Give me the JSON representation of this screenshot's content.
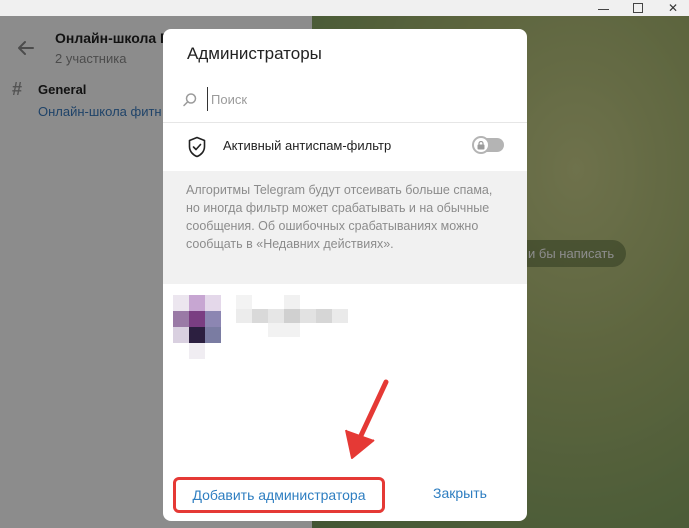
{
  "window": {
    "controls": {
      "minimize": "",
      "maximize": "",
      "close": "✕"
    }
  },
  "left": {
    "chat_title": "Онлайн-школа П",
    "chat_subtitle": "2 участника",
    "topic_name": "General",
    "topic_subtitle": "Онлайн-школа фитн"
  },
  "chat": {
    "hint": "и бы написать"
  },
  "modal": {
    "title": "Администраторы",
    "search_placeholder": "Поиск",
    "antispam_label": "Активный антиспам-фильтр",
    "antispam_enabled": false,
    "info_text": "Алгоритмы Telegram будут отсеивать больше спама, но иногда фильтр может срабатывать и на обычные сообщения. Об ошибочных срабатываниях можно сообщать в «Недавних действиях».",
    "add_admin_label": "Добавить администратора",
    "close_label": "Закрыть"
  },
  "colors": {
    "accent": "#2e7ec1",
    "highlight": "#e53935"
  }
}
